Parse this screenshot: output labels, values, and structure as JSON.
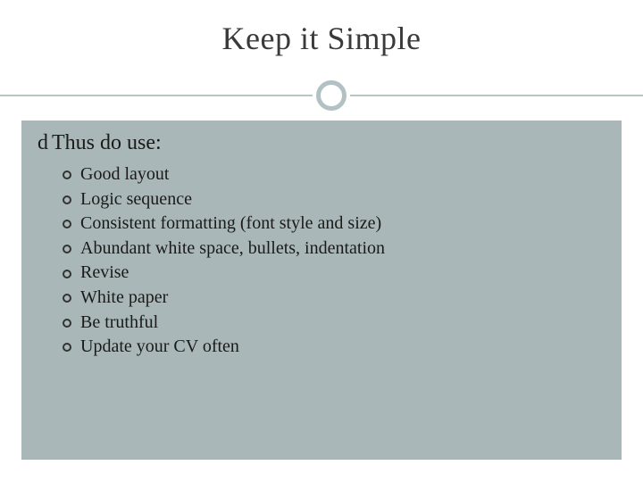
{
  "slide": {
    "title": "Keep it Simple",
    "bullet_glyph": "d",
    "heading": "Thus do use:",
    "items": [
      "Good layout",
      "Logic sequence",
      "Consistent formatting (font style and size)",
      "Abundant white space, bullets, indentation",
      "Revise",
      "White paper",
      "Be truthful",
      "Update your CV often"
    ]
  }
}
